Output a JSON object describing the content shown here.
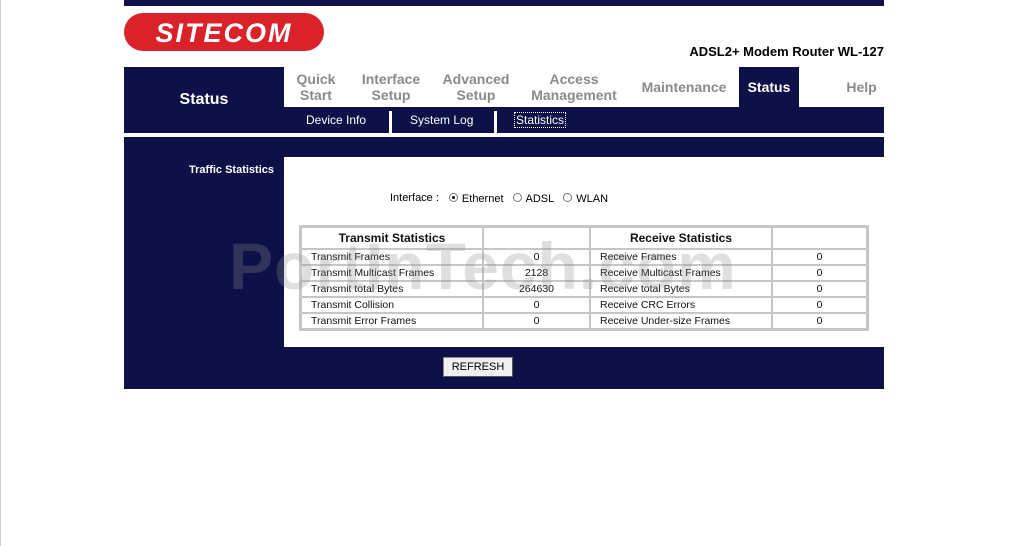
{
  "brand": {
    "logo_text": "SITECOM",
    "model": "ADSL2+ Modem Router WL-127",
    "accent": "#0e1148",
    "logo_color": "#d9222a"
  },
  "section_title": "Status",
  "tabs": [
    {
      "label": "Quick Start",
      "active": false
    },
    {
      "label": "Interface Setup",
      "active": false
    },
    {
      "label": "Advanced Setup",
      "active": false
    },
    {
      "label": "Access Management",
      "active": false
    },
    {
      "label": "Maintenance",
      "active": false
    },
    {
      "label": "Status",
      "active": true
    },
    {
      "label": "Help",
      "active": false
    }
  ],
  "subtabs": [
    {
      "label": "Device Info",
      "selected": false
    },
    {
      "label": "System Log",
      "selected": false
    },
    {
      "label": "Statistics",
      "selected": true
    }
  ],
  "sidebar_label": "Traffic Statistics",
  "interface": {
    "label": "Interface :",
    "options": [
      {
        "label": "Ethernet",
        "checked": true
      },
      {
        "label": "ADSL",
        "checked": false
      },
      {
        "label": "WLAN",
        "checked": false
      }
    ]
  },
  "stats": {
    "transmit_header": "Transmit Statistics",
    "receive_header": "Receive Statistics",
    "rows": [
      {
        "tx_label": "Transmit Frames",
        "tx_value": "0",
        "rx_label": "Receive Frames",
        "rx_value": "0"
      },
      {
        "tx_label": "Transmit Multicast Frames",
        "tx_value": "2128",
        "rx_label": "Receive Multicast Frames",
        "rx_value": "0"
      },
      {
        "tx_label": "Transmit total Bytes",
        "tx_value": "264630",
        "rx_label": "Receive total Bytes",
        "rx_value": "0"
      },
      {
        "tx_label": "Transmit Collision",
        "tx_value": "0",
        "rx_label": "Receive CRC Errors",
        "rx_value": "0"
      },
      {
        "tx_label": "Transmit Error Frames",
        "tx_value": "0",
        "rx_label": "Receive Under-size Frames",
        "rx_value": "0"
      }
    ]
  },
  "refresh_label": "REFRESH",
  "watermark": "PortInTech.com"
}
